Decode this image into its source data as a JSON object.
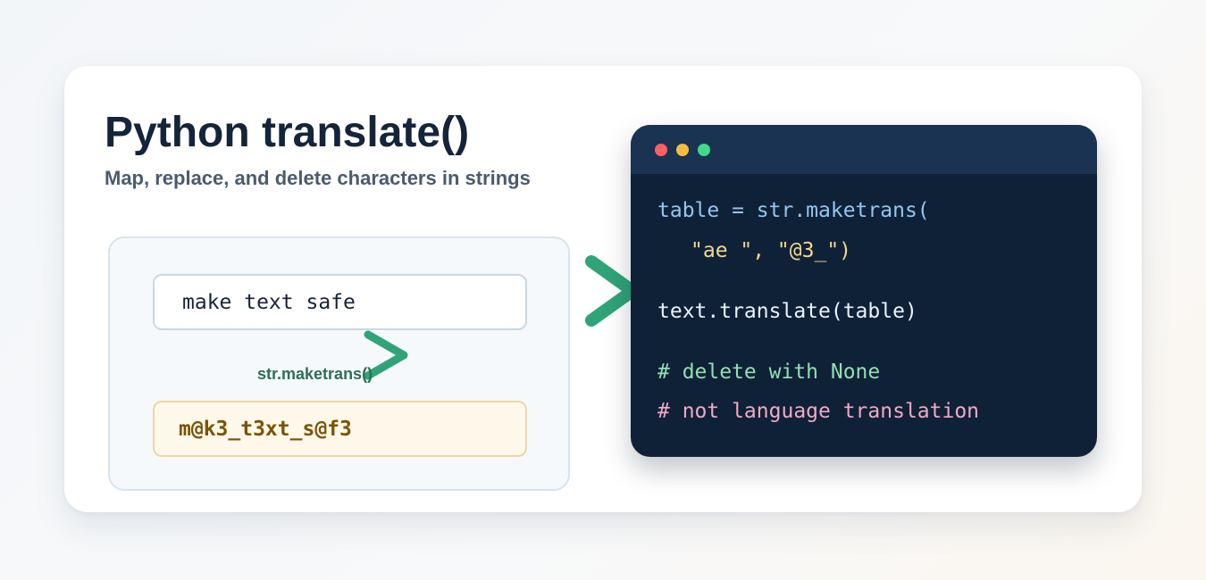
{
  "header": {
    "title": "Python translate()",
    "subtitle": "Map, replace, and delete characters in strings"
  },
  "demo": {
    "input_text": "make text safe",
    "method_label": "str.maketrans()",
    "output_text": "m@k3_t3xt_s@f3"
  },
  "code_window": {
    "lines": [
      "table = str.maketrans(",
      "\"ae \", \"@3_\")",
      "text.translate(table)",
      "# delete with None",
      "# not language translation"
    ]
  },
  "colors": {
    "accent_green": "#2fa478",
    "title": "#14243a",
    "code_background": "#0f2137",
    "output_text": "#7a5406"
  },
  "icons": [
    "window-dot-red-icon",
    "window-dot-yellow-icon",
    "window-dot-green-icon",
    "arrow-right-icon"
  ]
}
